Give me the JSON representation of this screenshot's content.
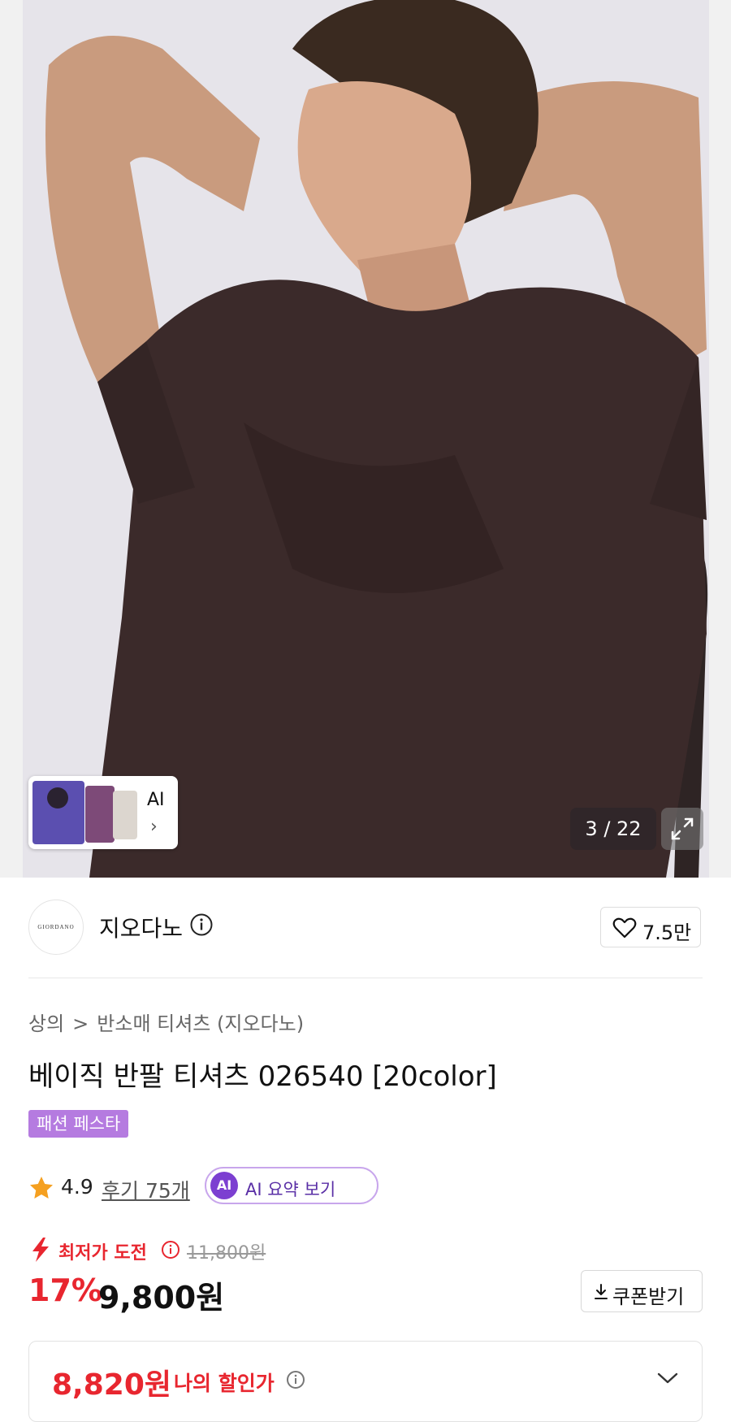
{
  "gallery": {
    "counter": "3 / 22",
    "ai_thumb_label": "AI",
    "chevron": "›"
  },
  "store": {
    "logo_text": "GIORDANO",
    "name": "지오다노",
    "favorite_count": "7.5만"
  },
  "breadcrumb": {
    "level1": "상의",
    "separator": ">",
    "level2": "반소매 티셔츠 (지오다노)"
  },
  "product": {
    "title": "베이직 반팔 티셔츠 026540 [20color]",
    "promo_badge": "패션 페스타"
  },
  "rating": {
    "score": "4.9",
    "reviews": "후기 75개",
    "ai_badge": "AI",
    "ai_summary_label": "AI 요약 보기"
  },
  "pricing": {
    "challenge_label": "최저가 도전",
    "original_price": "11,800원",
    "discount_percent": "17%",
    "sale_price": "9,800원",
    "coupon_label": "쿠폰받기",
    "my_price": "8,820원",
    "my_price_label": "나의 할인가"
  },
  "colors": {
    "accent_red": "#e8262f",
    "promo_purple": "#b57be0",
    "ai_purple": "#7c3fd1"
  },
  "icons": [
    "info-icon",
    "heart-icon",
    "star-icon",
    "bolt-icon",
    "download-icon",
    "chevron-down-icon",
    "expand-icon"
  ]
}
